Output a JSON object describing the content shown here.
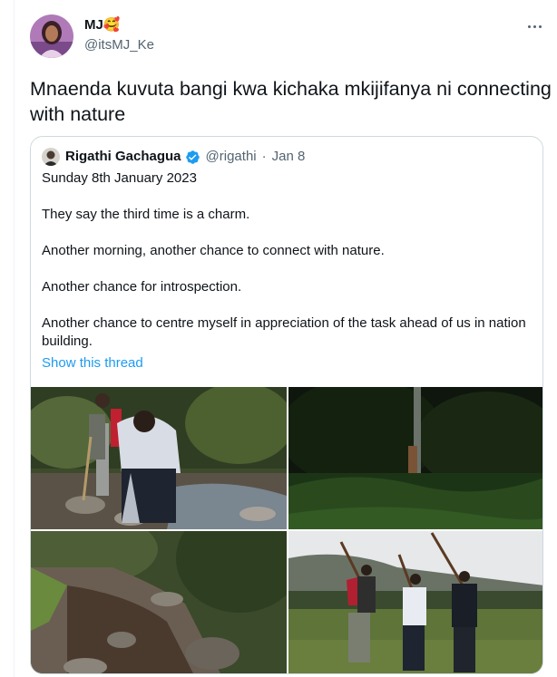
{
  "author": {
    "name": "MJ🥰",
    "handle": "@itsMJ_Ke"
  },
  "tweet_text": "Mnaenda kuvuta bangi kwa kichaka mkijifanya ni connecting with nature",
  "quoted_tweet": {
    "name": "Rigathi Gachagua",
    "handle": "@rigathi",
    "separator": "·",
    "date": "Jan 8",
    "lines": [
      "Sunday 8th January 2023",
      "They say the third time is a charm.",
      "Another morning, another chance to connect with nature.",
      "Another chance for introspection.",
      "Another chance to centre myself in appreciation of the task ahead of us in nation building."
    ],
    "show_thread": "Show this thread",
    "photos": [
      {
        "alt": "man-washing-face-at-stream"
      },
      {
        "alt": "dark-forest-clearing"
      },
      {
        "alt": "rocky-stream"
      },
      {
        "alt": "men-walking-with-sticks"
      }
    ]
  },
  "colors": {
    "text": "#0f1419",
    "secondary": "#536471",
    "link": "#1d9bf0",
    "border": "#cfd9de",
    "verified": "#1d9bf0"
  },
  "icons": {
    "more": "more-horizontal-icon",
    "verified": "verified-badge-icon"
  }
}
